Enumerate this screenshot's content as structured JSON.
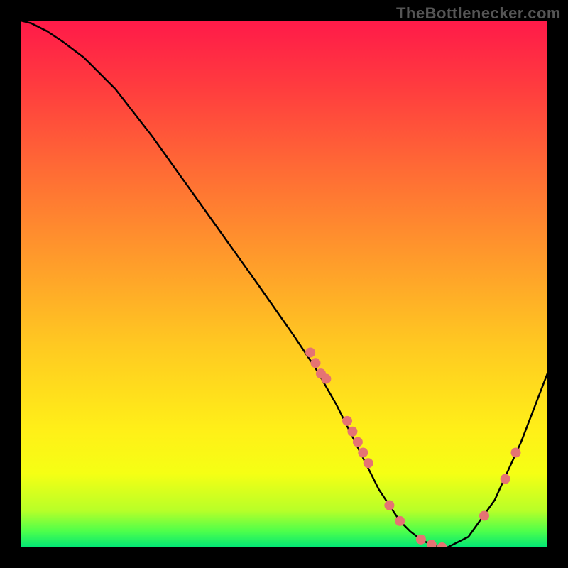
{
  "watermark": "TheBottlenecker.com",
  "chart_data": {
    "type": "line",
    "title": "",
    "xlabel": "",
    "ylabel": "",
    "xlim": [
      0,
      100
    ],
    "ylim": [
      0,
      100
    ],
    "background_gradient": {
      "colors": [
        "#ff1a49",
        "#ff3a3f",
        "#ff6a35",
        "#ff9a2b",
        "#ffca21",
        "#fff018",
        "#f5ff14",
        "#b8ff28",
        "#4cff4c",
        "#00e676"
      ],
      "positions": [
        0,
        0.12,
        0.28,
        0.45,
        0.62,
        0.78,
        0.86,
        0.93,
        0.97,
        1.0
      ]
    },
    "curve": {
      "x": [
        0,
        2,
        5,
        8,
        12,
        18,
        25,
        35,
        45,
        52,
        56,
        60,
        63,
        66,
        68,
        70,
        72,
        74,
        76,
        78,
        81,
        85,
        90,
        95,
        100
      ],
      "y": [
        100,
        99.5,
        98,
        96,
        93,
        87,
        78,
        64,
        50,
        40,
        34,
        27,
        21,
        15,
        11,
        8,
        5,
        3,
        1.5,
        0.5,
        0,
        2,
        9,
        20,
        33
      ]
    },
    "dots": {
      "x": [
        55,
        56,
        57,
        58,
        62,
        63,
        64,
        65,
        66,
        70,
        72,
        76,
        78,
        80,
        88,
        92,
        94
      ],
      "y": [
        37,
        35,
        33,
        32,
        24,
        22,
        20,
        18,
        16,
        8,
        5,
        1.5,
        0.5,
        0,
        6,
        13,
        18
      ],
      "color": "#e57373",
      "radius": 7
    }
  }
}
